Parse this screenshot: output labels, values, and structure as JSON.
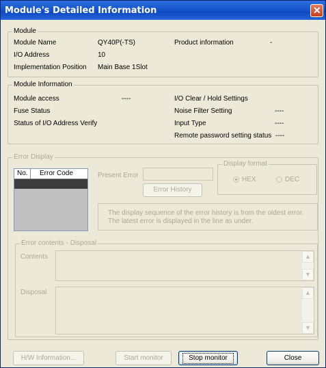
{
  "window": {
    "title": "Module's Detailed Information",
    "close_glyph": "✕"
  },
  "module": {
    "legend": "Module",
    "name_label": "Module Name",
    "name_value": "QY40P(-TS)",
    "product_label": "Product information",
    "product_value": "-",
    "io_label": "I/O Address",
    "io_value": "10",
    "impl_label": "Implementation Position",
    "impl_value": "Main Base  1Slot"
  },
  "module_info": {
    "legend": "Module Information",
    "access_label": "Module access",
    "access_value": "----",
    "fuse_label": "Fuse Status",
    "verify_label": "Status of I/O Address Verify",
    "ioclear_label": "I/O Clear / Hold Settings",
    "noise_label": "Noise Filter Setting",
    "noise_value": "----",
    "input_label": "Input Type",
    "input_value": "----",
    "remote_label": "Remote password setting status",
    "remote_value": "----"
  },
  "error_display": {
    "legend": "Error Display",
    "col_no": "No.",
    "col_code": "Error Code",
    "present_label": "Present Error",
    "history_button": "Error History",
    "format_legend": "Display format",
    "hex_label": "HEX",
    "dec_label": "DEC",
    "info_line1": "The display sequence of the error history is from the oldest error.",
    "info_line2": "The latest error is displayed in the line as under."
  },
  "error_contents": {
    "legend": "Error contents - Disposal",
    "contents_label": "Contents",
    "disposal_label": "Disposal"
  },
  "footer": {
    "hw_button": "H/W Information...",
    "start_button": "Start monitor",
    "stop_button": "Stop monitor",
    "close_button": "Close"
  }
}
